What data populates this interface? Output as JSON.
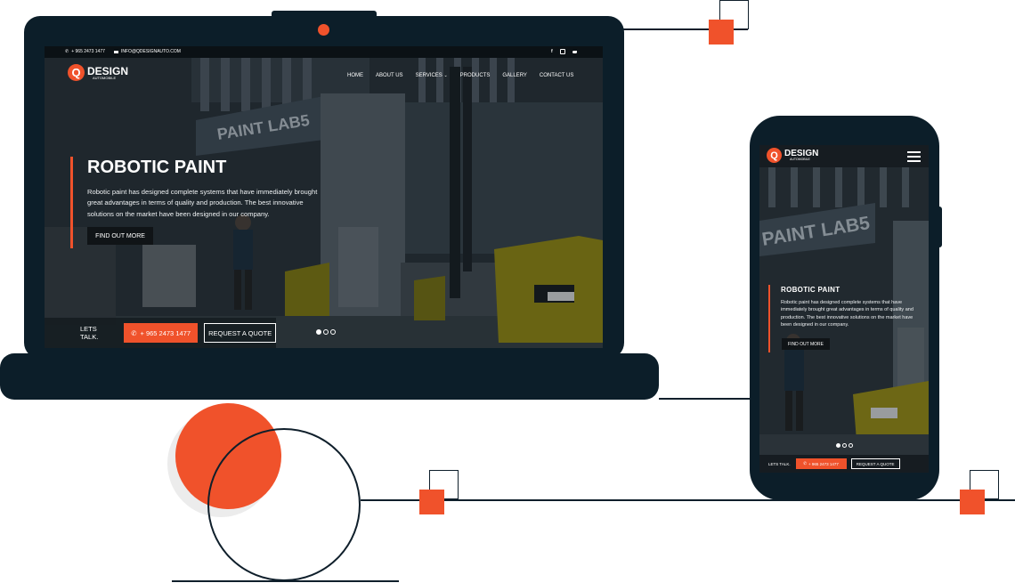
{
  "laptop": {
    "topbar": {
      "phone": "+ 965 2473 1477",
      "email": "INFO@QDESIGNAUTO.COM"
    },
    "logo": {
      "letter": "Q",
      "name": "DESIGN",
      "sub": "AUTOMOBILE"
    },
    "nav": [
      "HOME",
      "ABOUT US",
      "SERVICES",
      "PRODUCTS",
      "GALLERY",
      "CONTACT US"
    ],
    "scene": {
      "booth_sign": "PAINT LAB5"
    },
    "hero": {
      "title": "ROBOTIC PAINT",
      "description": "Robotic paint has designed complete systems that have immediately brought great advantages in terms of quality and production. The best innovative solutions on the market have been designed in our company.",
      "button": "FIND OUT MORE"
    },
    "cta": {
      "label": "LETS TALK.",
      "phone": "+ 965 2473 1477",
      "quote": "REQUEST A QUOTE"
    }
  },
  "phone": {
    "logo": {
      "letter": "Q",
      "name": "DESIGN",
      "sub": "AUTOMOBILE"
    },
    "scene": {
      "booth_sign": "PAINT LAB5"
    },
    "hero": {
      "title": "ROBOTIC PAINT",
      "description": "Robotic paint has designed complete systems that have immediately brought great advantages in terms of quality and production. The best innovative solutions on the market have been designed in our company.",
      "button": "FIND OUT MORE"
    },
    "cta": {
      "label": "LETS TALK.",
      "phone": "+ 965 2473 1477",
      "quote": "REQUEST A QUOTE"
    }
  },
  "colors": {
    "accent": "#f0522b",
    "dark": "#0c1e29"
  }
}
